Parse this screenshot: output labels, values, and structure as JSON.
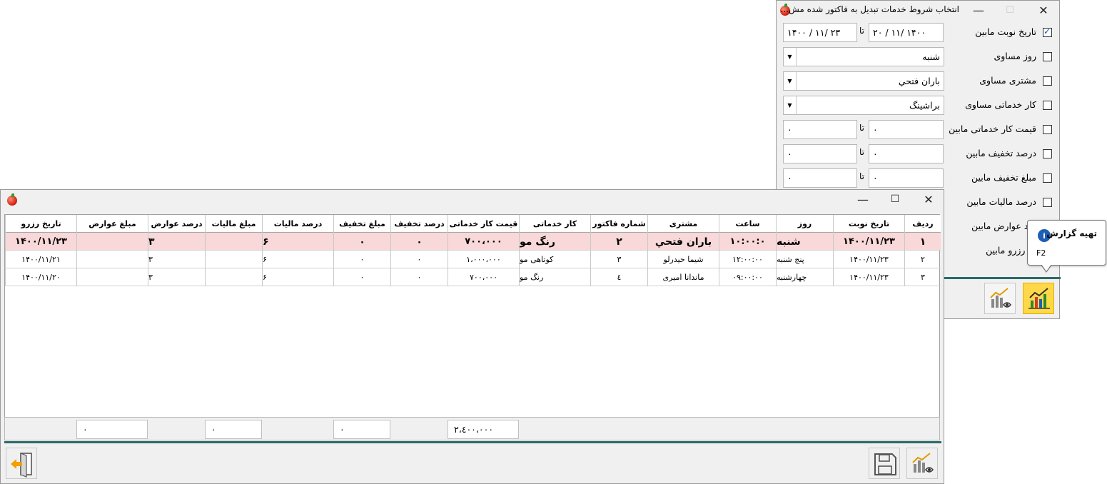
{
  "criteria": {
    "title": "انتخاب شروط خدمات تبدیل به فاکتور شده مش...",
    "to_label": "تا",
    "rows": [
      {
        "label": "تاریخ نوبت مابین",
        "checked": true,
        "from": "۲۰ / ۱۱/ ۱۴۰۰",
        "to": "۱۴۰۰ / ۱۱/ ۲۳"
      },
      {
        "label": "روز مساوی",
        "checked": false,
        "value": "شنبه"
      },
      {
        "label": "مشتری مساوی",
        "checked": false,
        "value": "باران فتحي"
      },
      {
        "label": "کار خدماتی مساوی",
        "checked": false,
        "value": "براشینگ"
      },
      {
        "label": "قیمت کار خدماتی مابین",
        "checked": false,
        "from": "۰",
        "to": "۰"
      },
      {
        "label": "درصد تخفیف مابین",
        "checked": false,
        "from": "۰",
        "to": "۰"
      },
      {
        "label": "مبلغ تخفیف مابین",
        "checked": false,
        "from": "۰",
        "to": "۰"
      },
      {
        "label": "درصد مالیات مابین",
        "checked": false
      },
      {
        "label": "صد عوارض مابین",
        "checked": false
      },
      {
        "label": "یخ رزرو مابین",
        "checked": false
      }
    ]
  },
  "tooltip": {
    "title": "تهیه گزارش",
    "shortcut": "F2"
  },
  "grid": {
    "columns": [
      "ردیف",
      "تاریخ نوبت",
      "روز",
      "ساعت",
      "مشتری",
      "شماره فاکتور",
      "کار خدماتی",
      "قیمت کار خدماتی",
      "درصد تخفیف",
      "مبلغ تخفیف",
      "درصد مالیات",
      "مبلغ مالیات",
      "درصد عوارض",
      "مبلغ عوارض",
      "تاریخ رزرو"
    ],
    "rows": [
      [
        "۱",
        "۱۴۰۰/۱۱/۲۳",
        "شنبه",
        "۱۰:۰۰:۰",
        "باران فتحي",
        "۲",
        "رنگ مو",
        "۷۰۰،۰۰۰",
        "۰",
        "۰",
        "۶",
        "",
        "۳",
        "",
        "۱۴۰۰/۱۱/۲۳"
      ],
      [
        "۲",
        "۱۴۰۰/۱۱/۲۳",
        "پنج شنبه",
        "۱۲:۰۰:۰۰",
        "شیما حیدرلو",
        "۳",
        "کوتاهی مو",
        "۱،۰۰۰،۰۰۰",
        "۰",
        "۰",
        "۶",
        "",
        "۳",
        "",
        "۱۴۰۰/۱۱/۲۱"
      ],
      [
        "۳",
        "۱۴۰۰/۱۱/۲۳",
        "چهارشنبه",
        "۰۹:۰۰:۰۰",
        "ماندانا امیری",
        "٤",
        "رنگ مو",
        "۷۰۰،۰۰۰",
        "۰",
        "۰",
        "۶",
        "",
        "۳",
        "",
        "۱۴۰۰/۱۱/۲۰"
      ]
    ],
    "totals": {
      "price": "۲،٤۰۰،۰۰۰",
      "discount": "۰",
      "tax": "۰",
      "toll": "۰"
    }
  },
  "colors": {
    "accent": "#2a6b6b",
    "selected_row": "#f8d8d8",
    "highlight_button": "#ffd84a"
  },
  "icons": [
    "app-tomato-icon",
    "chart-report-icon",
    "chart-preview-icon",
    "save-disk-icon",
    "exit-door-icon",
    "info-icon",
    "minimize-icon",
    "maximize-icon",
    "close-icon"
  ]
}
